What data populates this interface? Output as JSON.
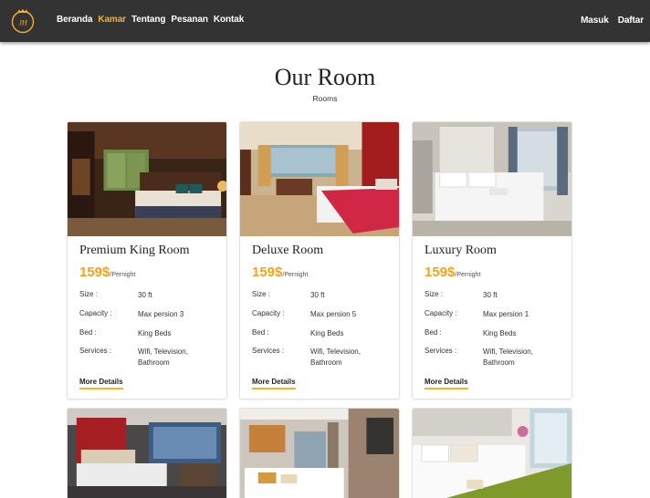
{
  "nav": {
    "logo_text": "JH",
    "links": [
      {
        "label": "Beranda",
        "active": false
      },
      {
        "label": "Kamar",
        "active": true
      },
      {
        "label": "Tentang",
        "active": false
      },
      {
        "label": "Pesanan",
        "active": false
      },
      {
        "label": "Kontak",
        "active": false
      }
    ],
    "login_label": "Masuk",
    "register_label": "Daftar",
    "accent_color": "#f5b22b"
  },
  "header": {
    "title": "Our Room",
    "subtitle": "Rooms"
  },
  "rooms": [
    {
      "name": "Premium King Room",
      "price": "159$",
      "price_unit": "/Pernight",
      "size_label": "Size :",
      "size": "30 ft",
      "capacity_label": "Capacity :",
      "capacity": "Max persion 3",
      "bed_label": "Bed :",
      "bed": "King Beds",
      "services_label": "Services :",
      "services": "Wifi, Television, Bathroom",
      "details_label": "More Details"
    },
    {
      "name": "Deluxe Room",
      "price": "159$",
      "price_unit": "/Pernight",
      "size_label": "Size :",
      "size": "30 ft",
      "capacity_label": "Capacity :",
      "capacity": "Max persion 5",
      "bed_label": "Bed :",
      "bed": "King Beds",
      "services_label": "Services :",
      "services": "Wifi, Television, Bathroom",
      "details_label": "More Details"
    },
    {
      "name": "Luxury Room",
      "price": "159$",
      "price_unit": "/Pernight",
      "size_label": "Size :",
      "size": "30 ft",
      "capacity_label": "Capacity :",
      "capacity": "Max persion 1",
      "bed_label": "Bed :",
      "bed": "King Beds",
      "services_label": "Services :",
      "services": "Wifi, Television, Bathroom",
      "details_label": "More Details"
    }
  ]
}
